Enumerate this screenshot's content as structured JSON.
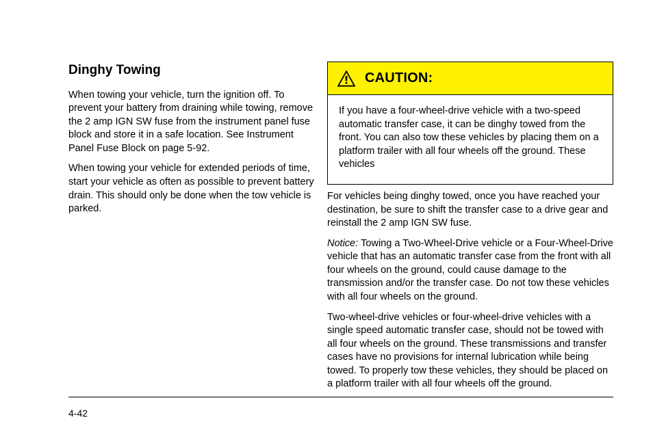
{
  "left": {
    "heading": "Dinghy Towing",
    "paragraphs": [
      "When towing your vehicle, turn the ignition off. To prevent your battery from draining while towing, remove the 2 amp IGN SW fuse from the instrument panel fuse block and store it in a safe location. See Instrument Panel Fuse Block on page 5-92.",
      "When towing your vehicle for extended periods of time, start your vehicle as often as possible to prevent battery drain. This should only be done when the tow vehicle is parked."
    ]
  },
  "caution": {
    "title": "CAUTION:",
    "body_parts": [
      {
        "text": "If you have a four-wheel-drive vehicle with a two-speed automatic transfer case, it can be dinghy towed from the front. You can also tow these vehicles by placing them on a platform trailer with all four wheels off the ground. These vehicles ",
        "em": false
      }
    ]
  },
  "right_below": {
    "paragraphs": [
      [
        {
          "text": "For vehicles being dinghy towed, once you have reached your destination, be sure to shift the transfer case to a drive gear and reinstall the 2 amp IGN SW fuse.",
          "em": false
        }
      ],
      [
        {
          "text": "Notice: ",
          "em": true
        },
        {
          "text": "Towing a Two-Wheel-Drive vehicle or a Four-Wheel-Drive vehicle that has an automatic transfer case from the front with all four wheels on the ground, could cause damage to the transmission and/or the transfer case. Do not tow these vehicles with all four wheels on the ground.",
          "em": false
        }
      ],
      [
        {
          "text": "Two-wheel-drive vehicles or four-wheel-drive vehicles with a single speed automatic transfer case, should not be towed with all four wheels on the ground. These transmissions and transfer cases have no provisions for internal lubrication while being towed. To properly tow these vehicles, they should be placed on a platform trailer with all four wheels off the ground.",
          "em": false
        }
      ]
    ]
  },
  "page_number": "4-42"
}
